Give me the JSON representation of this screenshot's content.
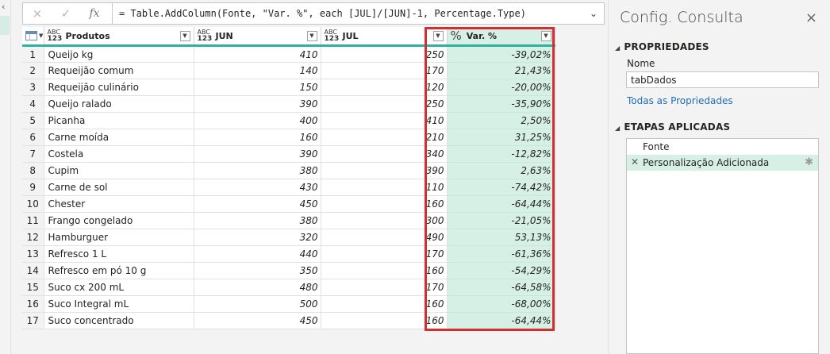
{
  "formula_bar": {
    "cancel_icon": "×",
    "confirm_icon": "✓",
    "fx_label": "fx",
    "formula": "= Table.AddColumn(Fonte, \"Var. %\", each [JUL]/[JUN]-1, Percentage.Type)",
    "expand_icon": "⌄"
  },
  "table": {
    "type_badge_line1": "ABC",
    "type_badge_line2": "123",
    "percent_badge": "%",
    "columns": [
      "Produtos",
      "JUN",
      "JUL",
      "Var. %"
    ],
    "rows": [
      {
        "n": "1",
        "produto": "Queijo kg",
        "jun": "410",
        "jul": "250",
        "var": "-39,02%"
      },
      {
        "n": "2",
        "produto": "Requeijão comum",
        "jun": "140",
        "jul": "170",
        "var": "21,43%"
      },
      {
        "n": "3",
        "produto": "Requeijão culinário",
        "jun": "150",
        "jul": "120",
        "var": "-20,00%"
      },
      {
        "n": "4",
        "produto": "Queijo ralado",
        "jun": "390",
        "jul": "250",
        "var": "-35,90%"
      },
      {
        "n": "5",
        "produto": "Picanha",
        "jun": "400",
        "jul": "410",
        "var": "2,50%"
      },
      {
        "n": "6",
        "produto": "Carne moída",
        "jun": "160",
        "jul": "210",
        "var": "31,25%"
      },
      {
        "n": "7",
        "produto": "Costela",
        "jun": "390",
        "jul": "340",
        "var": "-12,82%"
      },
      {
        "n": "8",
        "produto": "Cupim",
        "jun": "380",
        "jul": "390",
        "var": "2,63%"
      },
      {
        "n": "9",
        "produto": "Carne de sol",
        "jun": "430",
        "jul": "110",
        "var": "-74,42%"
      },
      {
        "n": "10",
        "produto": "Chester",
        "jun": "450",
        "jul": "160",
        "var": "-64,44%"
      },
      {
        "n": "11",
        "produto": "Frango congelado",
        "jun": "380",
        "jul": "300",
        "var": "-21,05%"
      },
      {
        "n": "12",
        "produto": "Hamburguer",
        "jun": "320",
        "jul": "490",
        "var": "53,13%"
      },
      {
        "n": "13",
        "produto": "Refresco 1 L",
        "jun": "440",
        "jul": "170",
        "var": "-61,36%"
      },
      {
        "n": "14",
        "produto": "Refresco em pó 10 g",
        "jun": "350",
        "jul": "160",
        "var": "-54,29%"
      },
      {
        "n": "15",
        "produto": "Suco cx 200 mL",
        "jun": "480",
        "jul": "170",
        "var": "-64,58%"
      },
      {
        "n": "16",
        "produto": "Suco Integral mL",
        "jun": "500",
        "jul": "160",
        "var": "-68,00%"
      },
      {
        "n": "17",
        "produto": "Suco concentrado",
        "jun": "450",
        "jul": "160",
        "var": "-64,44%"
      }
    ]
  },
  "pane": {
    "title": "Config. Consulta",
    "close_icon": "×",
    "properties_heading": "PROPRIEDADES",
    "name_label": "Nome",
    "name_value": "tabDados",
    "all_properties_link": "Todas as Propriedades",
    "steps_heading": "ETAPAS APLICADAS",
    "steps": [
      "Fonte",
      "Personalização Adicionada"
    ]
  },
  "colors": {
    "accent_teal": "#2fb39e",
    "selected_column": "#d6f0e5",
    "highlight_box": "#d62e30",
    "link": "#1f6db2"
  }
}
